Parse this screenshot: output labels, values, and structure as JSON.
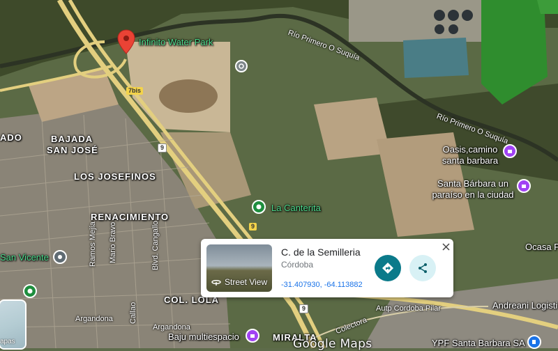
{
  "map": {
    "places": {
      "water_park": "Infinito Water Park",
      "canterita": "La Canterita",
      "oasis": "Oasis,camino santa barbara",
      "santa_barbara": "Santa Bárbara un paraíso en la ciudad",
      "ocasa": "Ocasa P",
      "san_vicente": "San Vicente",
      "andreani": "Andreani Logisti",
      "baju": "Baju multiespacio",
      "ypf": "YPF Santa Barbara SA"
    },
    "areas": {
      "bajada": "BAJADA",
      "san_jose": "SAN JOSÉ",
      "ado": "ADO",
      "los_josefinos": "LOS JOSEFINOS",
      "renacimiento": "RENACIMIENTO",
      "col_lola": "COL. LOLA",
      "miralta": "MIRALTA"
    },
    "streets": {
      "ramos_mejia": "Ramos Mejía",
      "mario_bravo": "Mario Bravo",
      "blvd_cangallo": "Blvd. Cangallo",
      "callao": "Callao",
      "argandona1": "Argandona",
      "argandona2": "Argandona",
      "autopista": "Autp Cordoba Pilar",
      "colectora": "Colectora"
    },
    "rivers": {
      "upper": "Río Primero O Suquía",
      "right": "Río Primero O Suquía"
    },
    "shields": {
      "r7bis": "7bis",
      "r9_a": "9",
      "r9_b": "9",
      "r9_c": "9"
    }
  },
  "card": {
    "title": "C. de la Semilleria",
    "subtitle": "Córdoba",
    "coords": "-31.407930, -64.113882",
    "street_view": "Street View"
  },
  "layers": {
    "label": "apas"
  },
  "logo": "Google Maps",
  "colors": {
    "teal": "#0b7a8a",
    "poi_green": "#1e8e3e",
    "poi_purple": "#a142f4",
    "pin_red": "#ea4335",
    "link_blue": "#1a73e8"
  }
}
